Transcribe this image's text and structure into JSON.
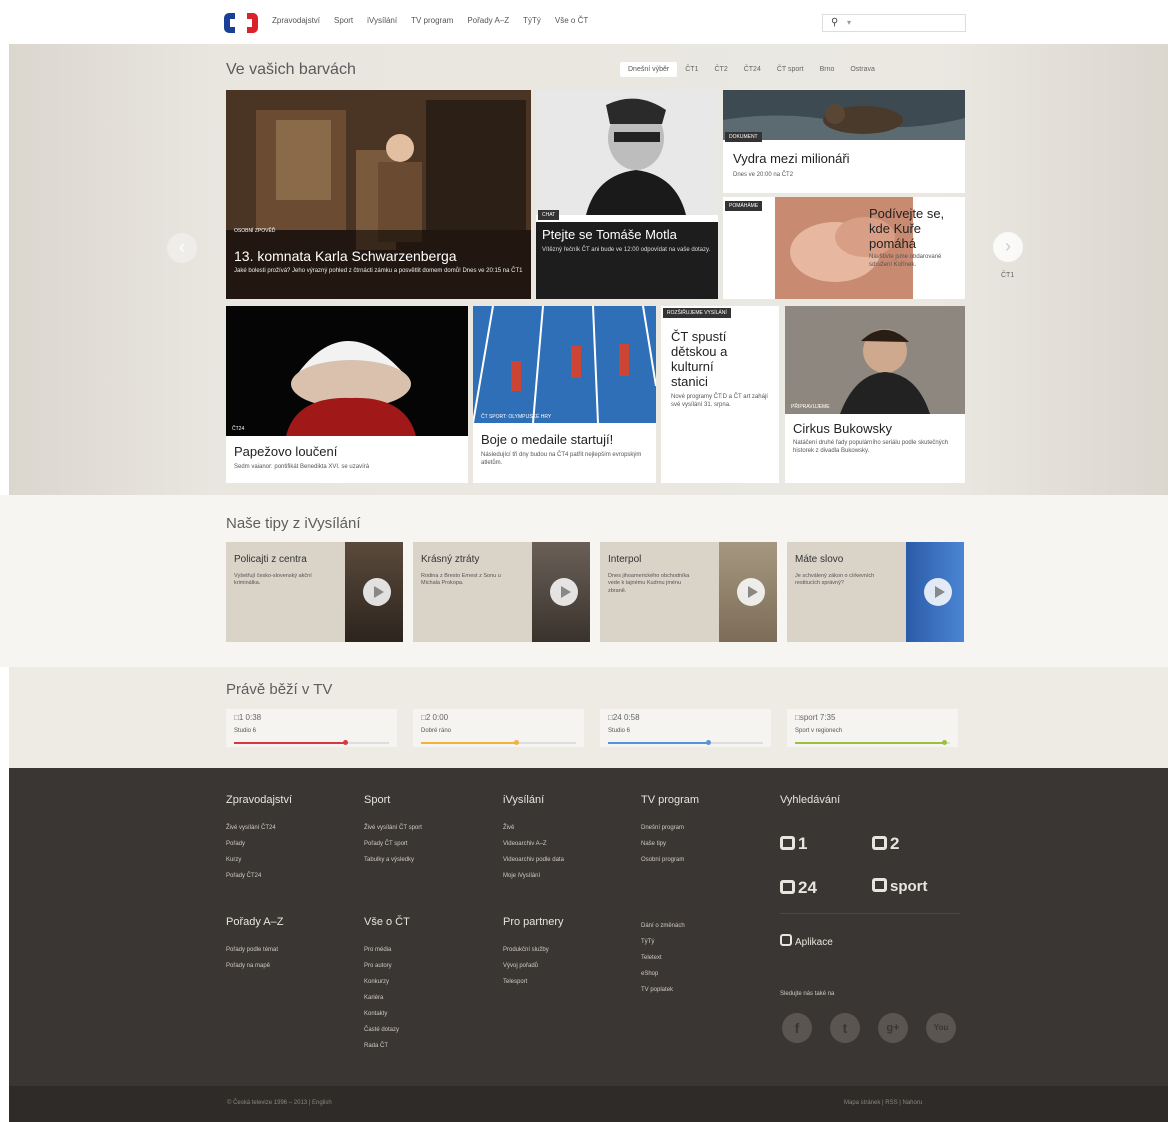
{
  "nav": {
    "items": [
      "Zpravodajství",
      "Sport",
      "iVysílání",
      "TV program",
      "Pořady A–Z",
      "TýTý",
      "Vše o ČT"
    ],
    "search_placeholder": "▾"
  },
  "hero": {
    "title": "Ve vašich barvách",
    "tabs": [
      "Dnešní výběr",
      "ČT1",
      "ČT2",
      "ČT24",
      "ČT sport",
      "Brno",
      "Ostrava"
    ],
    "next_label": "ČT1",
    "cards": [
      {
        "tag": "Osobní zpověď",
        "title": "13. komnata Karla Schwarzenberga",
        "desc": "Jaké bolesti prožívá? Jeho výrazný pohled z čtrnácti zámku a posvětlit domem domů! Dnes ve 20:15 na ČT1"
      },
      {
        "tag": "Chat",
        "title": "Ptejte se Tomáše Motla",
        "desc": "Vítězný řečník ČT ani bude ve 12:00 odpovídat na vaše dotazy."
      },
      {
        "tag": "Dokument",
        "title": "Vydra mezi milionáři",
        "desc": "Dnes ve 20:00 na ČT2"
      },
      {
        "tag": "Pomáháme",
        "title": "Podívejte se, kde Kuře pomáhá",
        "desc": "Navštivte jsme obdarované sdružení Kořínek."
      },
      {
        "tag": "ČT24",
        "title": "Papežovo loučení",
        "desc": "Sedm vaianor: pontifikát Benedikta XVI. se uzavírá"
      },
      {
        "tag": "ČT sport: Olympijské hry",
        "title": "Boje o medaile startují!",
        "desc": "Následující tři dny budou na ČT4 patřit nejlepším evropským atletům."
      },
      {
        "tag": "Rozšiřujeme vysílání",
        "title": "ČT spustí dětskou a kulturní stanici",
        "desc": "Nové programy ČT:D a ČT art zahájí své vysílání 31. srpna."
      },
      {
        "tag": "Připravujeme",
        "title": "Cirkus Bukowsky",
        "desc": "Natáčení druhé řady populárního seriálu podle skutečných historek z divadla Bukowsky."
      }
    ]
  },
  "tips": {
    "title": "Naše tipy z iVysílání",
    "items": [
      {
        "title": "Policajti z centra",
        "desc": "Vyšetřují česko-slovenský akční kriminálka."
      },
      {
        "title": "Krásný ztráty",
        "desc": "Rodina z Bresto Ernest z Sonu u Michala Prokopa."
      },
      {
        "title": "Interpol",
        "desc": "Dnes jihoamerického obchodníka vede k tajnému Kudrnu jménu zbraně."
      },
      {
        "title": "Máte slovo",
        "desc": "Je schválený zákon o církevních restitucích správný?"
      }
    ]
  },
  "now": {
    "title": "Právě běží v TV",
    "items": [
      {
        "channel": "1",
        "time": "0:38",
        "program": "Studio 6",
        "color": "#d7373f",
        "progress": 0.72
      },
      {
        "channel": "2",
        "time": "0:00",
        "program": "Dobré ráno",
        "color": "#f0b23c",
        "progress": 0.62
      },
      {
        "channel": "24",
        "time": "0:58",
        "program": "Studio 6",
        "color": "#5594d8",
        "progress": 0.65
      },
      {
        "channel": "sport",
        "time": "7:35",
        "program": "Sport v regionech",
        "color": "#9bc13c",
        "progress": 0.97
      }
    ]
  },
  "footer": {
    "cols": [
      {
        "title": "Zpravodajství",
        "links": [
          "Živé vysílání ČT24",
          "Pořady",
          "Kurzy",
          "Pořady ČT24"
        ]
      },
      {
        "title": "Sport",
        "links": [
          "Živé vysílání ČT sport",
          "Pořady ČT sport",
          "Tabulky a výsledky"
        ]
      },
      {
        "title": "iVysílání",
        "links": [
          "Živě",
          "Videoarchiv A–Z",
          "Videoarchiv podle data",
          "Moje iVysílání"
        ]
      },
      {
        "title": "TV program",
        "links": [
          "Dnešní program",
          "Naše tipy",
          "Osobní program"
        ]
      },
      {
        "title": "Pořady A–Z",
        "links": [
          "Pořady podle témat",
          "Pořady na mapě"
        ]
      },
      {
        "title": "Vše o ČT",
        "links": [
          "Pro média",
          "Pro autory",
          "Konkurzy",
          "Kariéra",
          "Kontakty",
          "Časté dotazy",
          "Rada ČT"
        ]
      },
      {
        "title": "Pro partnery",
        "links": [
          "Produkční služby",
          "Vývoj pořadů",
          "Telesport"
        ]
      },
      {
        "title": "",
        "links": [
          "Dání o změnách",
          "TýTý",
          "Teletext",
          "eShop",
          "TV poplatek"
        ]
      }
    ],
    "search_title": "Vyhledávání",
    "channels": [
      "1",
      "2",
      "24",
      "sport"
    ],
    "app_label": "Aplikace",
    "social_label": "Sledujte nás také na",
    "social": [
      "f",
      "t",
      "g+",
      "You"
    ],
    "copyright": "© Česká televize 1996 – 2013 | English",
    "links_right": "Mapa stránek | RSS | Nahoru"
  }
}
